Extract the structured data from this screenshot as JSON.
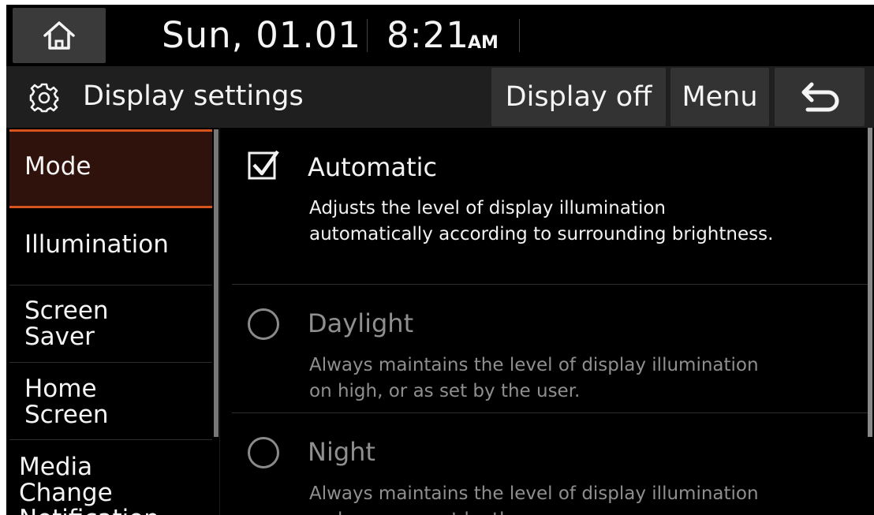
{
  "status": {
    "date": "Sun, 01.01",
    "time": "8:21",
    "ampm": "AM"
  },
  "header": {
    "title": "Display settings",
    "display_off_label": "Display off",
    "menu_label": "Menu"
  },
  "sidebar": {
    "items": [
      {
        "label": "Mode",
        "active": true
      },
      {
        "label": "Illumination"
      },
      {
        "label": "Screen\nSaver"
      },
      {
        "label": "Home\nScreen"
      },
      {
        "label": "Media\nChange\nNotification"
      }
    ]
  },
  "options": [
    {
      "title": "Automatic",
      "checked": true,
      "enabled": true,
      "description": "Adjusts the level of display illumination automatically according to surrounding brightness."
    },
    {
      "title": "Daylight",
      "checked": false,
      "enabled": false,
      "description": "Always maintains the level of display illumination on high, or as set by the user."
    },
    {
      "title": "Night",
      "checked": false,
      "enabled": false,
      "description": "Always maintains the level of display illumination on low, or as set by the user."
    }
  ],
  "icons": {
    "home": "home-icon",
    "settings": "gear-icon",
    "back": "back-arrow-icon",
    "check": "checkbox-checked-icon",
    "radio": "radio-unselected-icon"
  },
  "colors": {
    "accent": "#d9531e",
    "active_bg": "#2e120b",
    "background": "#000000",
    "disabled_text": "#8f8f8f"
  }
}
